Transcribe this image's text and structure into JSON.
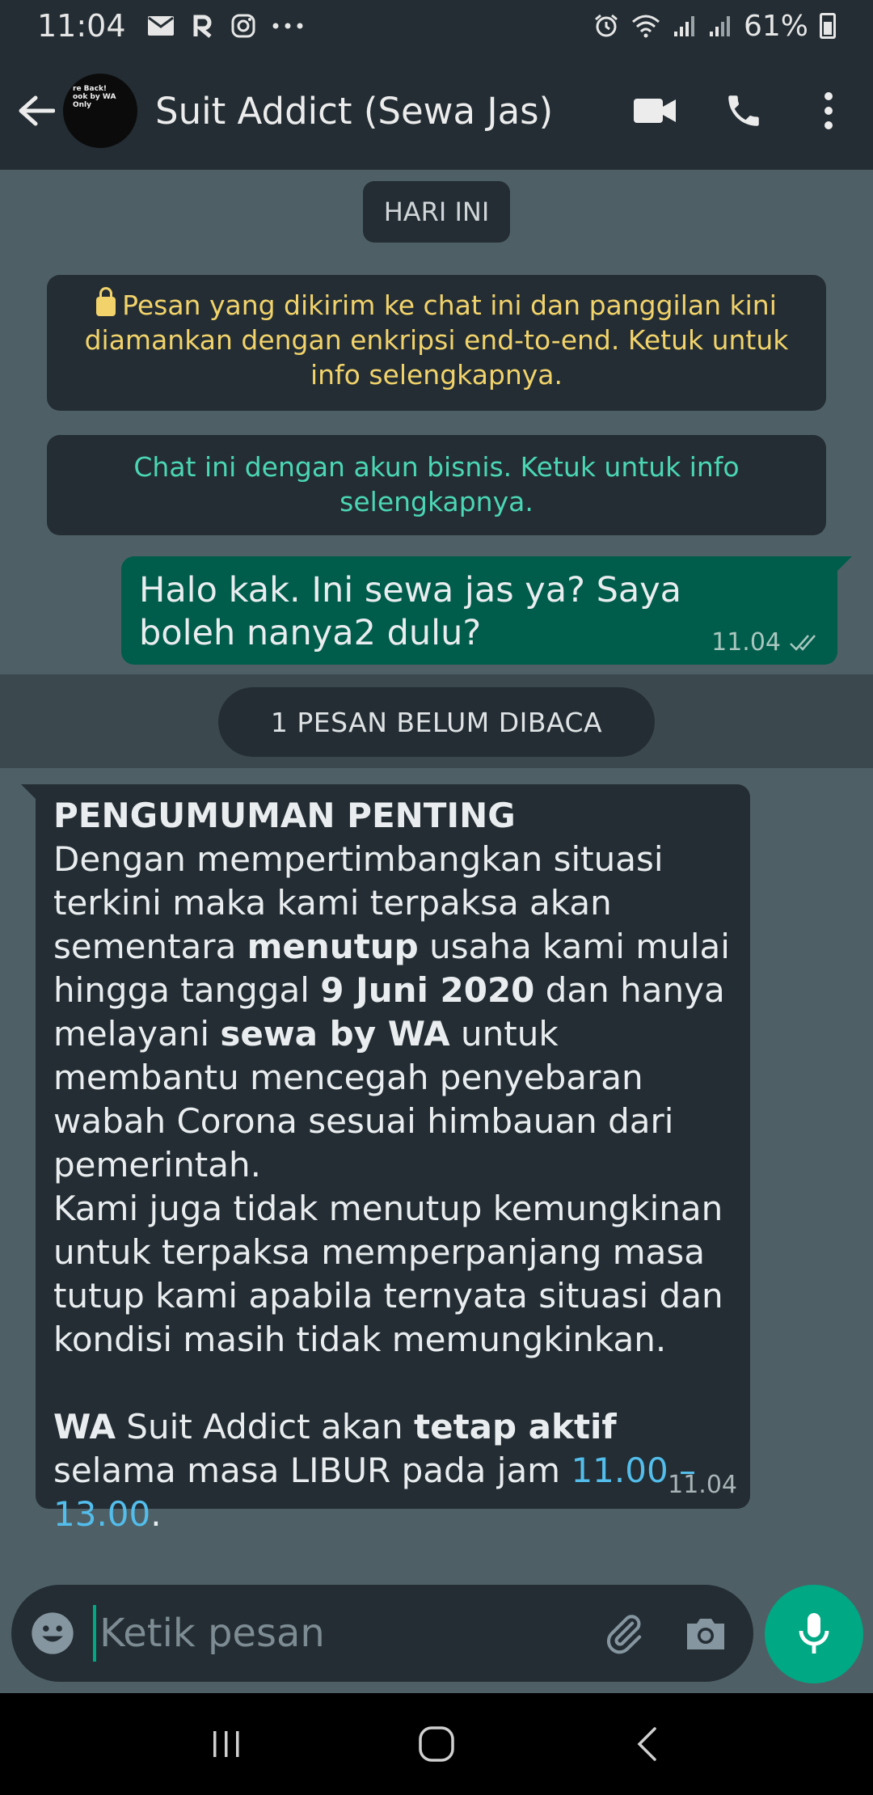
{
  "status_bar": {
    "time": "11:04",
    "battery": "61%",
    "icons_left": [
      "mail-icon",
      "app-icon",
      "instagram-icon",
      "more-notifications-icon"
    ],
    "icons_right": [
      "alarm-icon",
      "wifi-icon",
      "signal-icon",
      "signal-icon",
      "battery-icon"
    ]
  },
  "app_bar": {
    "title": "Suit Addict (Sewa Jas)",
    "avatar_text": "re Back! ook by WA Only",
    "actions": [
      "video-call-icon",
      "voice-call-icon",
      "more-options-icon"
    ]
  },
  "chat": {
    "date_chip": "HARI INI",
    "encryption_notice": "Pesan yang dikirim ke chat ini dan panggilan kini diamankan dengan enkripsi end-to-end. Ketuk untuk info selengkapnya.",
    "business_notice": "Chat ini dengan akun bisnis. Ketuk untuk info selengkapnya.",
    "outgoing_message": {
      "text": "Halo kak. Ini sewa jas ya? Saya boleh nanya2 dulu?",
      "time": "11.04"
    },
    "unread_chip": "1 PESAN BELUM DIBACA",
    "incoming_message": {
      "heading": "PENGUMUMAN PENTING",
      "p1_a": "Dengan mempertimbangkan situasi terkini maka kami terpaksa akan sementara ",
      "p1_b": "menutup",
      "p1_c": " usaha kami mulai hingga tanggal ",
      "p1_d": "9 Juni 2020",
      "p1_e": " dan hanya melayani ",
      "p1_f": "sewa by WA",
      "p1_g": " untuk membantu mencegah penyebaran wabah Corona sesuai himbauan dari pemerintah.",
      "p2": "Kami juga tidak menutup kemungkinan untuk terpaksa memperpanjang masa tutup kami apabila ternyata situasi dan kondisi masih tidak memungkinkan.",
      "p3_a": "WA",
      "p3_b": " Suit Addict akan ",
      "p3_c": "tetap aktif",
      "p3_d": " selama masa LIBUR pada jam ",
      "p3_e": "11.00 – 13.00",
      "p3_f": ".",
      "time": "11.04"
    }
  },
  "input_bar": {
    "placeholder": "Ketik pesan",
    "value": ""
  },
  "nav_bar": [
    "recent-apps-icon",
    "home-icon",
    "back-nav-icon"
  ]
}
